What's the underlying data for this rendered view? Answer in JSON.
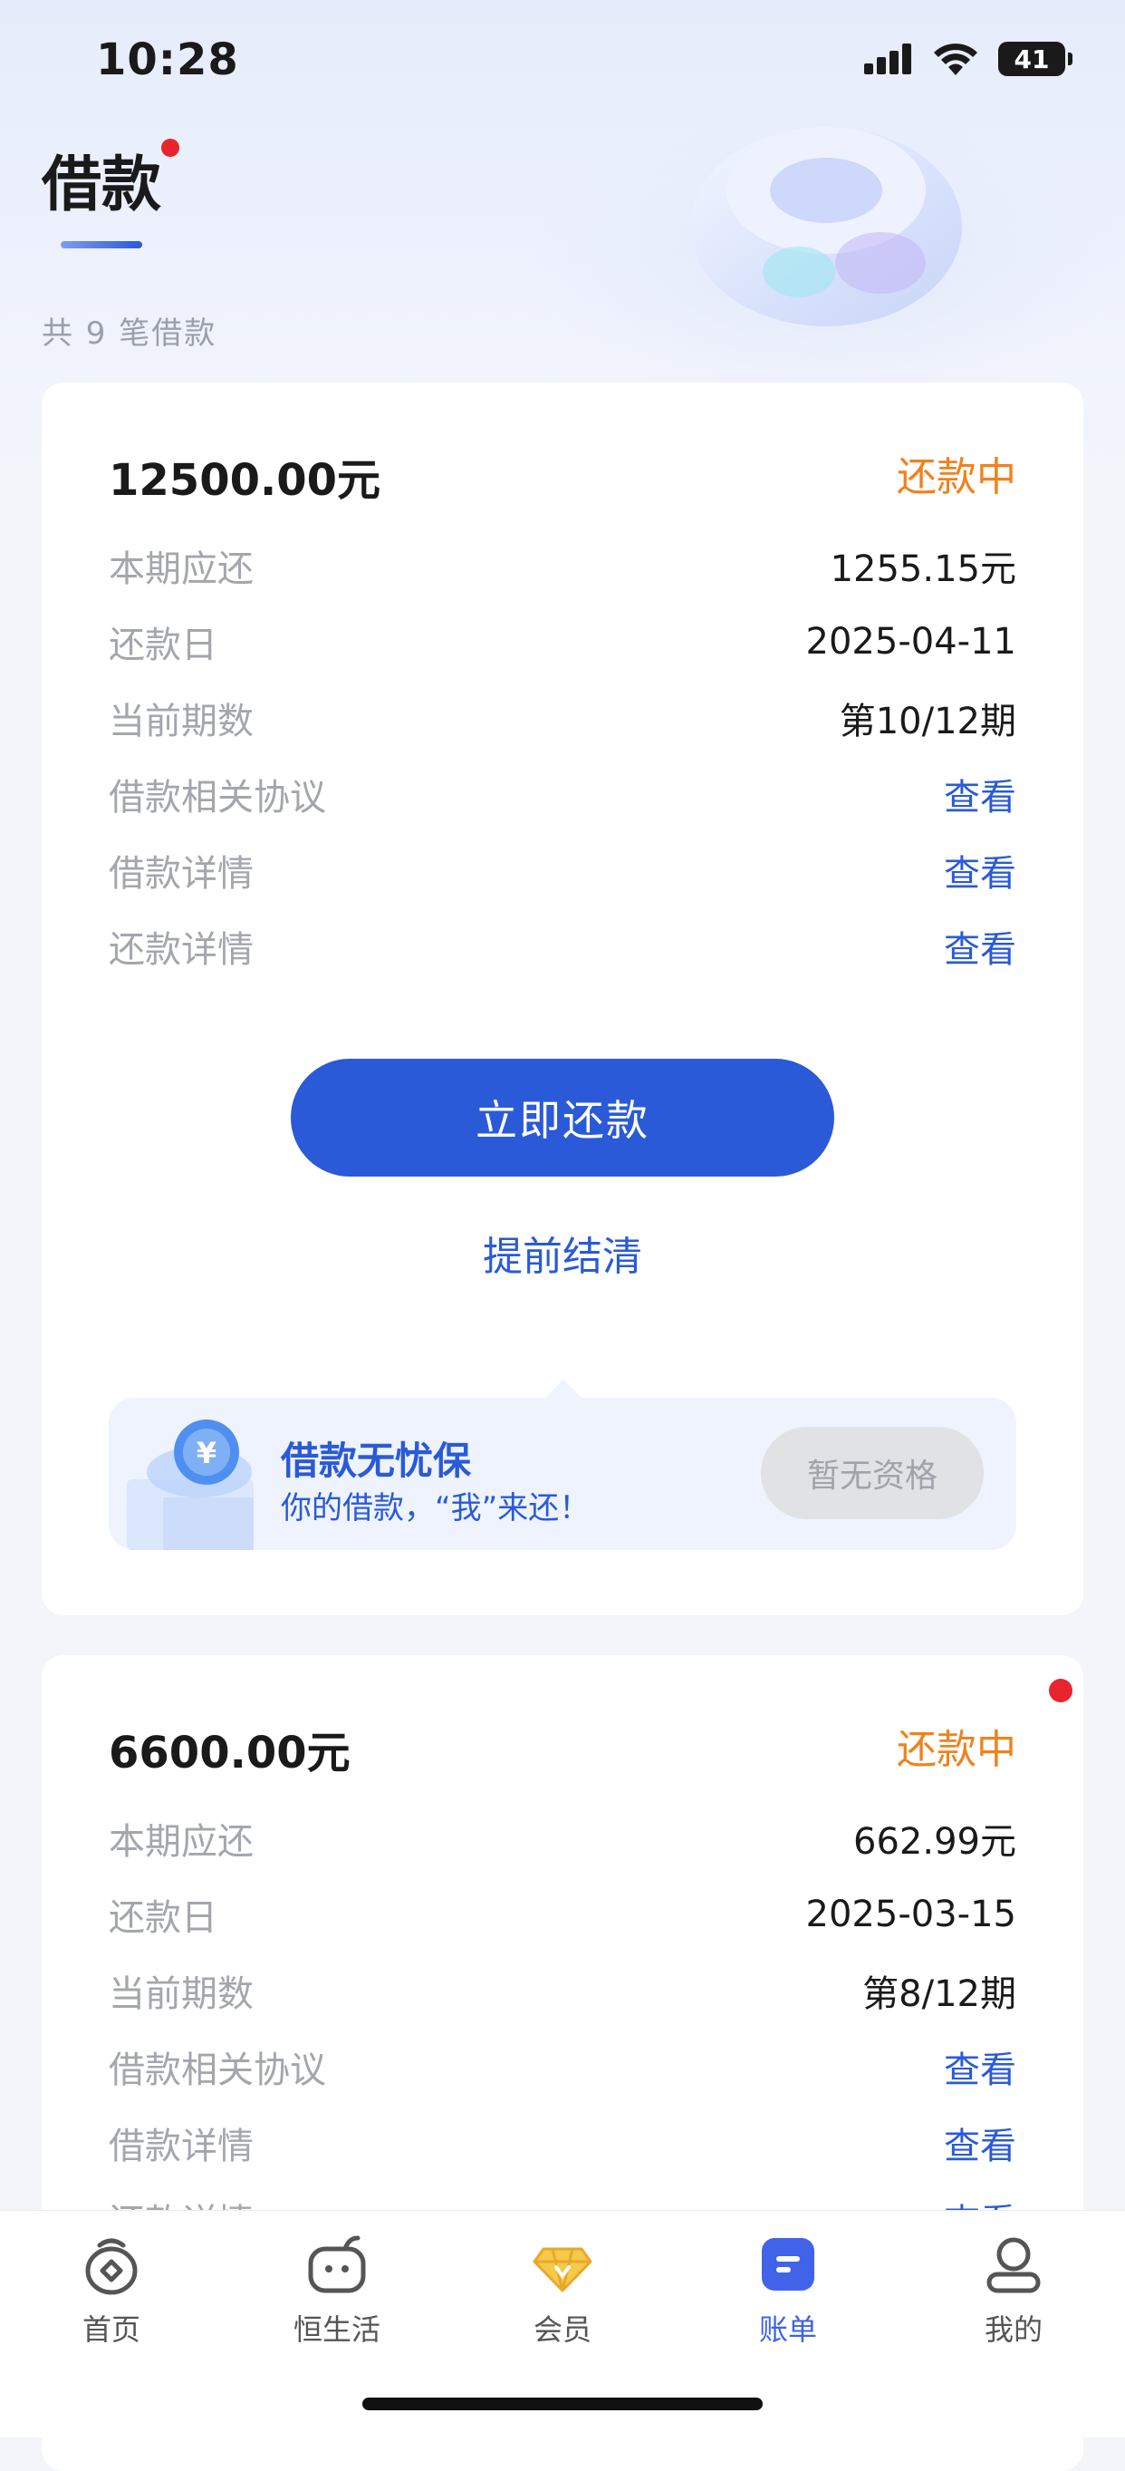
{
  "status_bar": {
    "time": "10:28",
    "battery": "41"
  },
  "header": {
    "title": "借款",
    "loan_count": "共 9 笔借款"
  },
  "loans": [
    {
      "amount": "12500.00元",
      "status": "还款中",
      "rows": [
        {
          "label": "本期应还",
          "value": "1255.15元"
        },
        {
          "label": "还款日",
          "value": "2025-04-11"
        },
        {
          "label": "当前期数",
          "value": "第10/12期"
        },
        {
          "label": "借款相关协议",
          "value": "查看"
        },
        {
          "label": "借款详情",
          "value": "查看"
        },
        {
          "label": "还款详情",
          "value": "查看"
        }
      ],
      "pay_button": "立即还款",
      "early_settle": "提前结清",
      "insurance": {
        "title": "借款无忧保",
        "subtitle": "你的借款，“我”来还！",
        "button": "暂无资格"
      }
    },
    {
      "amount": "6600.00元",
      "status": "还款中",
      "rows": [
        {
          "label": "本期应还",
          "value": "662.99元"
        },
        {
          "label": "还款日",
          "value": "2025-03-15"
        },
        {
          "label": "当前期数",
          "value": "第8/12期"
        },
        {
          "label": "借款相关协议",
          "value": "查看"
        },
        {
          "label": "借款详情",
          "value": "查看"
        },
        {
          "label": "还款详情",
          "value": "查看"
        }
      ]
    }
  ],
  "tab_bar": {
    "active": "账单",
    "tabs": [
      {
        "label": "首页",
        "icon": "home-icon"
      },
      {
        "label": "恒生活",
        "icon": "life-icon"
      },
      {
        "label": "会员",
        "icon": "member-diamond-icon"
      },
      {
        "label": "账单",
        "icon": "bill-icon"
      },
      {
        "label": "我的",
        "icon": "profile-icon"
      }
    ]
  },
  "colors": {
    "primary": "#2a5ad8",
    "status_orange": "#f0821d",
    "badge_red": "#e8242c",
    "label_gray": "#a3a6ad"
  }
}
